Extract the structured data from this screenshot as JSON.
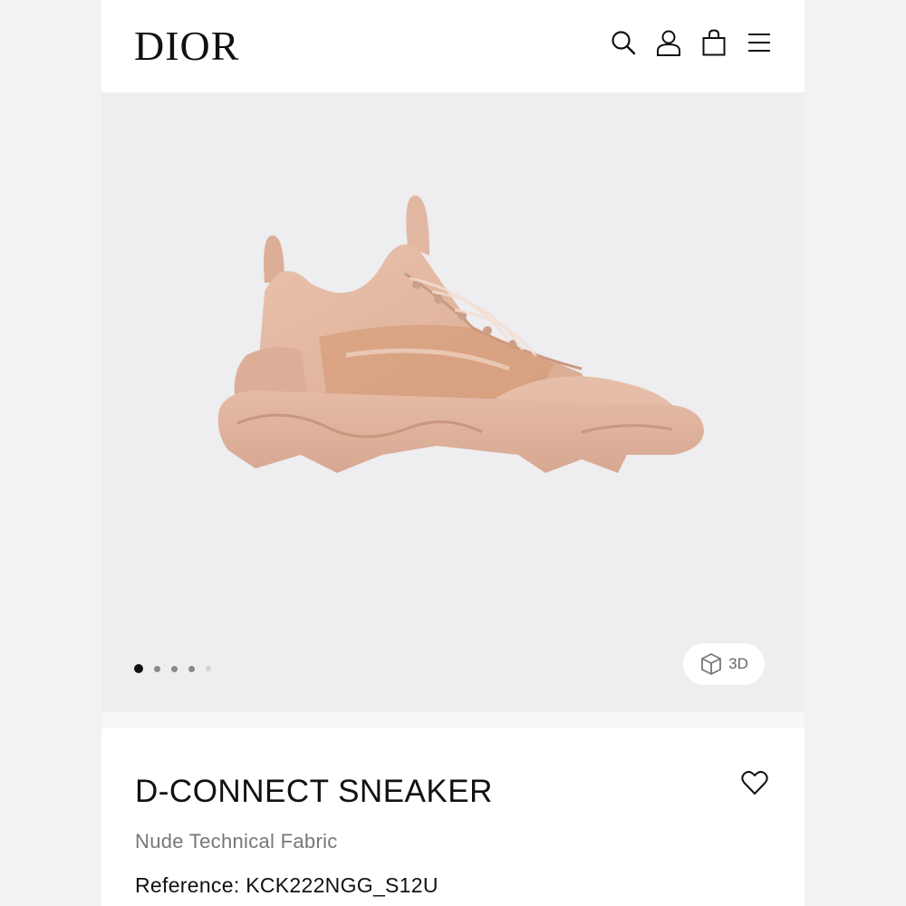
{
  "brand": {
    "logo_text": "DIOR"
  },
  "header": {
    "icons": [
      "search-icon",
      "account-icon",
      "shopping-bag-icon",
      "menu-icon"
    ]
  },
  "gallery": {
    "image_count": 5,
    "active_index": 0,
    "view_3d_label": "3D"
  },
  "product": {
    "name": "D-CONNECT SNEAKER",
    "material": "Nude Technical Fabric",
    "reference": "Reference: KCK222NGG_S12U"
  },
  "colors": {
    "shoe": "#e3b8a2",
    "hero_bg": "#eeedf0"
  }
}
